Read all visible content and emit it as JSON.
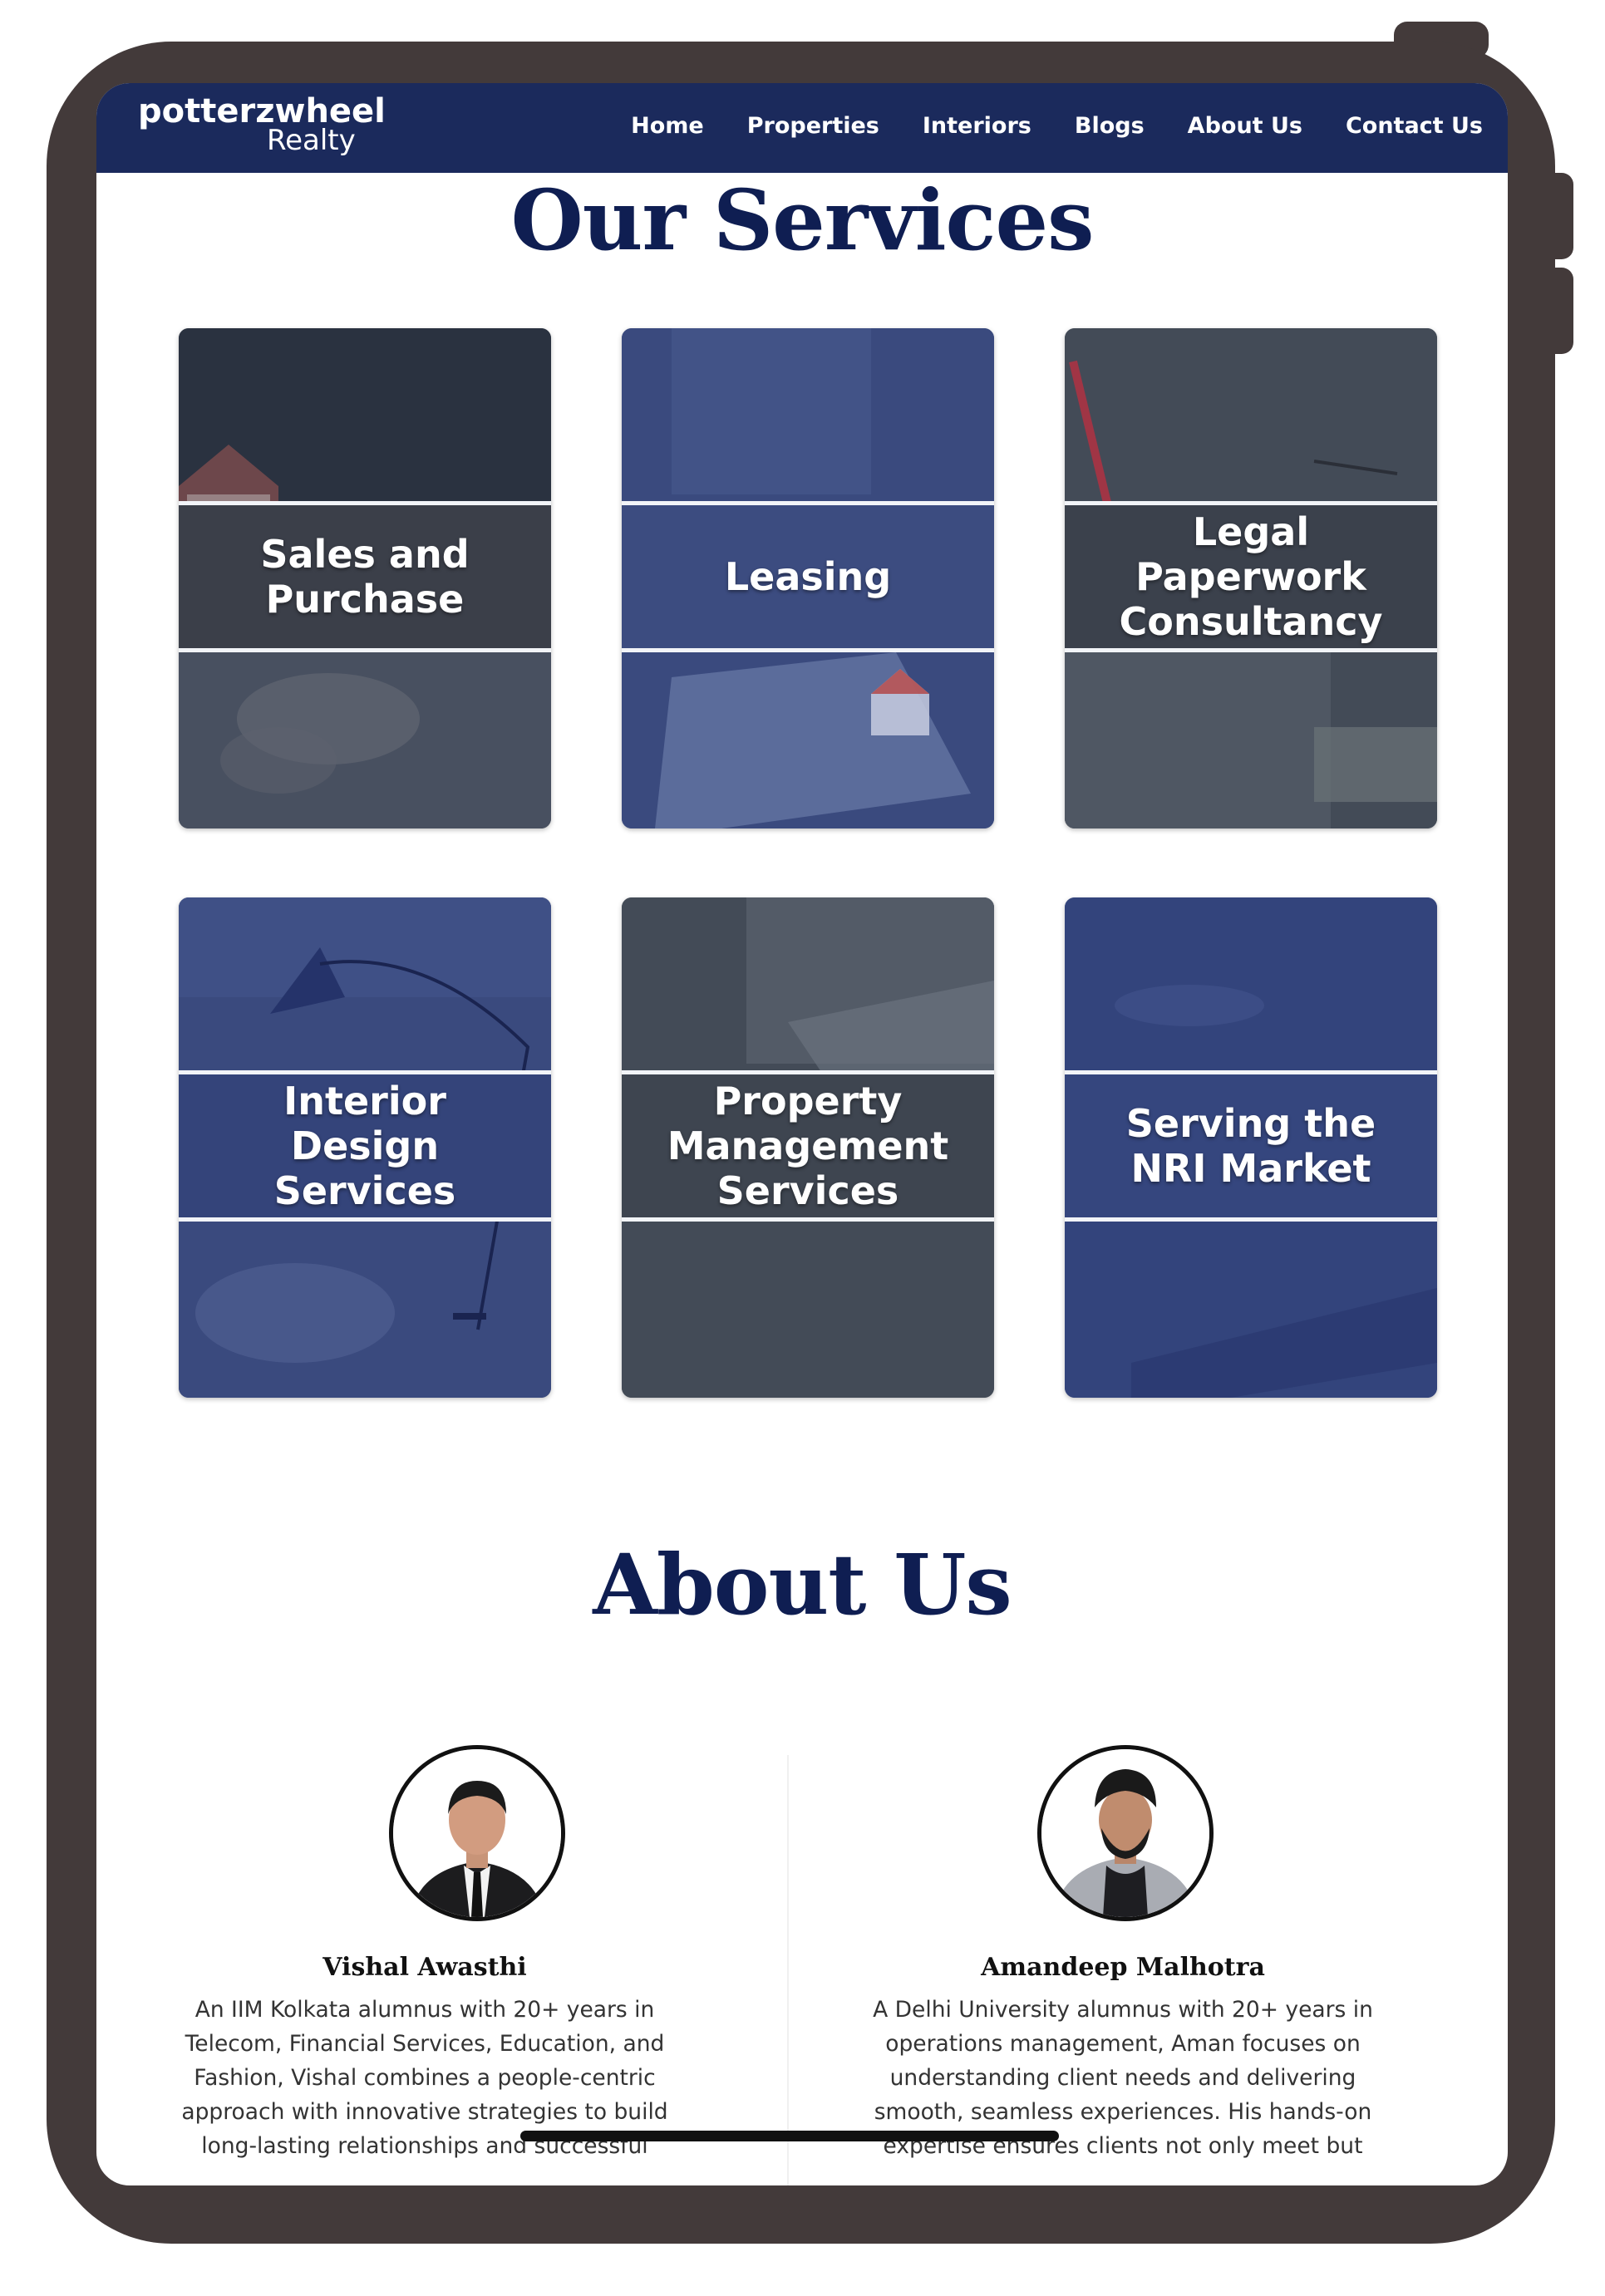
{
  "brand": {
    "logo_main": "potterzwheel",
    "logo_sub": "Realty"
  },
  "nav": {
    "items": [
      {
        "label": "Home"
      },
      {
        "label": "Properties"
      },
      {
        "label": "Interiors"
      },
      {
        "label": "Blogs"
      },
      {
        "label": "About Us"
      },
      {
        "label": "Contact Us"
      }
    ]
  },
  "services": {
    "title": "Our Services",
    "cards": [
      {
        "label": "Sales and\nPurchase"
      },
      {
        "label": "Leasing"
      },
      {
        "label": "Legal\nPaperwork\nConsultancy"
      },
      {
        "label": "Interior\nDesign\nServices"
      },
      {
        "label": "Property\nManagement\nServices"
      },
      {
        "label": "Serving the\nNRI Market"
      }
    ]
  },
  "about": {
    "title": "About Us",
    "team": [
      {
        "name": "Vishal Awasthi",
        "bio": "An IIM Kolkata alumnus with 20+ years in Telecom, Financial Services, Education, and Fashion, Vishal combines a people-centric approach with innovative strategies to build long-lasting relationships and successful"
      },
      {
        "name": "Amandeep Malhotra",
        "bio": "A Delhi University alumnus with 20+ years in operations management, Aman focuses on understanding client needs and delivering smooth, seamless experiences. His hands-on expertise ensures clients not only meet but"
      }
    ]
  },
  "colors": {
    "navbar": "#1b2a5c",
    "heading": "#0f1e52",
    "device_frame": "#433a3a",
    "card_blue": "#3a4a7e",
    "card_slate": "#434b57"
  }
}
